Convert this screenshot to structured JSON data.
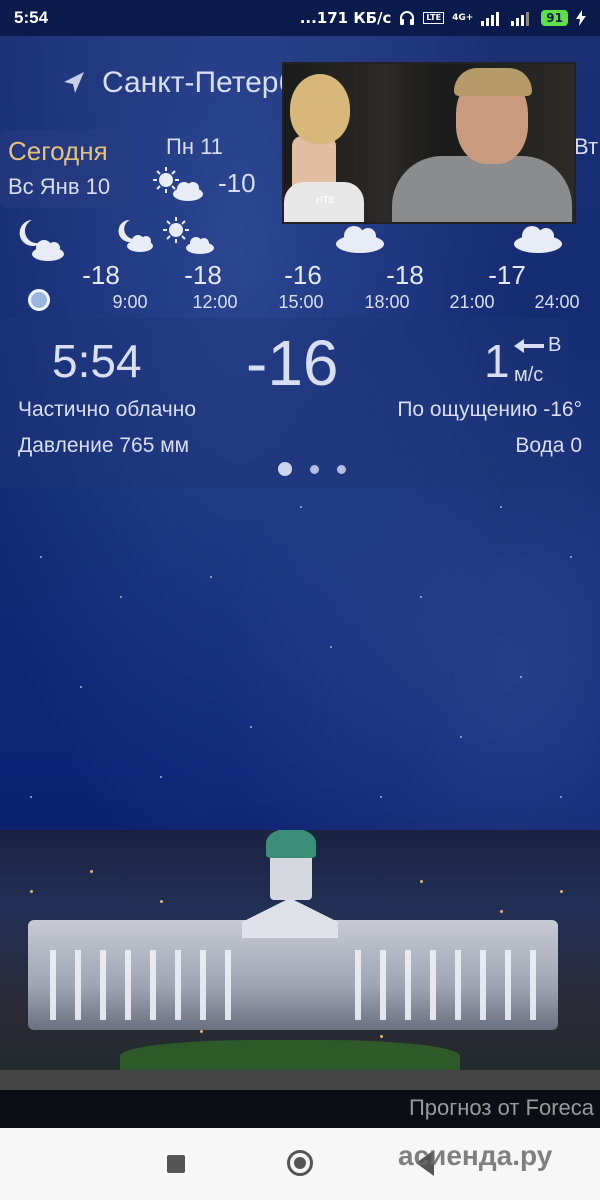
{
  "status_bar": {
    "time": "5:54",
    "speed": "...171 КБ/с",
    "lte": "LTE",
    "network": "4G+",
    "battery": "91"
  },
  "location": {
    "city": "Санкт-Петерб",
    "icon": "location-arrow-icon"
  },
  "days": [
    {
      "name": "Сегодня",
      "date": "Вс Янв 10"
    },
    {
      "name": "Пн 11",
      "temp": "-10",
      "icon": "partly-cloudy-day-icon"
    },
    {
      "name": "Вт"
    }
  ],
  "hourly": {
    "icons": [
      "partly-cloudy-night-icon",
      "partly-cloudy-night-icon",
      "partly-cloudy-day-icon",
      "cloud-icon",
      "cloud-icon"
    ],
    "temps": [
      "-18",
      "-18",
      "-16",
      "-18",
      "-17"
    ],
    "times": [
      "9:00",
      "12:00",
      "15:00",
      "18:00",
      "21:00",
      "24:00"
    ]
  },
  "current": {
    "time": "5:54",
    "temp": "-16",
    "wind_speed": "1",
    "wind_dir": "В",
    "wind_unit": "м/с",
    "condition": "Частично облачно",
    "feels_like": "По ощущению -16°",
    "pressure": "Давление 765 мм",
    "water": "Вода 0"
  },
  "video": {
    "logo": "НТВ"
  },
  "footer": {
    "credit": "Прогноз от Foreca",
    "watermark": "асиенда.ру"
  },
  "colors": {
    "accent_today": "#e5c27a",
    "sky_top": "#1b2f74",
    "sky_bottom": "#0b1c55",
    "battery": "#5ee04a"
  }
}
